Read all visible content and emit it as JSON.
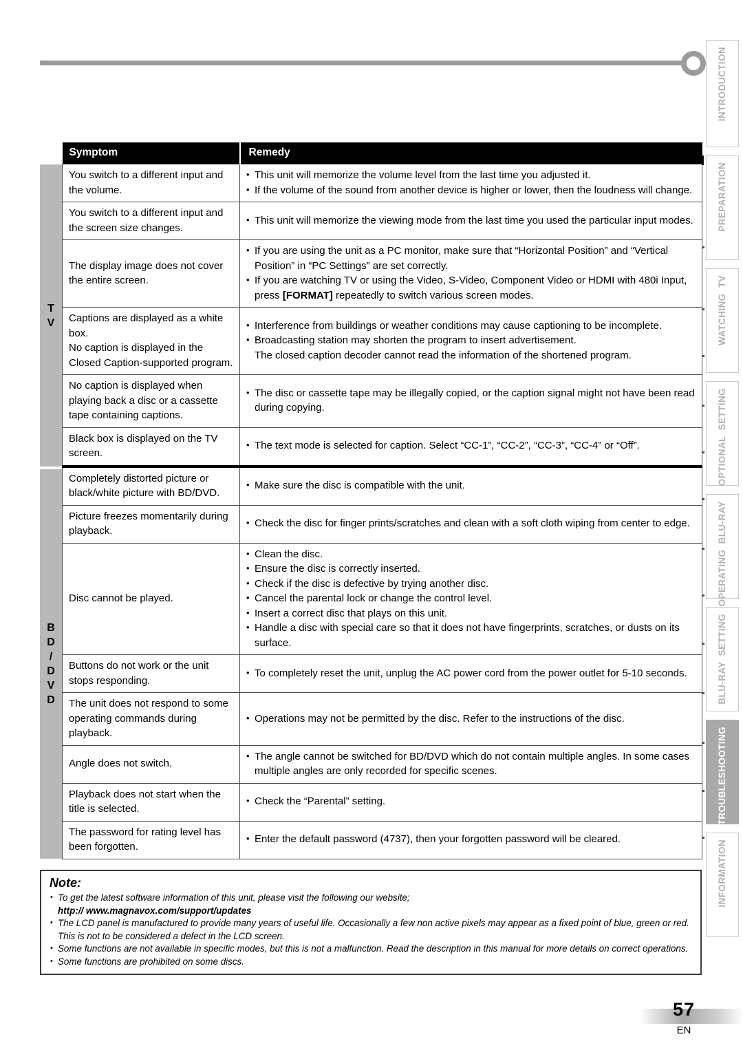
{
  "page": {
    "number": "57",
    "language": "EN"
  },
  "side_tabs": [
    {
      "label": "INTRODUCTION",
      "active": false
    },
    {
      "label": "PREPARATION",
      "active": false
    },
    {
      "label": "WATCHING  TV",
      "active": false
    },
    {
      "label": "OPTIONAL  SETTING",
      "active": false
    },
    {
      "label": "OPERATING  BLU-RAY",
      "active": false
    },
    {
      "label": "BLU-RAY  SETTING",
      "active": false
    },
    {
      "label": "TROUBLESHOOTING",
      "active": true
    },
    {
      "label": "INFORMATION",
      "active": false
    }
  ],
  "categories": {
    "tv": "T\nV",
    "bddvd": "B\nD\n/\nD\nV\nD"
  },
  "table": {
    "headers": {
      "symptom": "Symptom",
      "remedy": "Remedy"
    },
    "rows": [
      {
        "symptom": "You switch to a different input and the volume.",
        "remedy": [
          "This unit will memorize the volume level from the last time you adjusted it.",
          "If the volume of the sound from another device is higher or lower, then the loudness will change."
        ]
      },
      {
        "symptom": "You switch to a different input and the screen size changes.",
        "remedy": [
          "This unit will memorize the viewing mode from the last time you used the particular input modes."
        ]
      },
      {
        "symptom": "The display image does not cover the entire screen.",
        "remedy": [
          "If you are using the unit as a PC monitor, make sure that “Horizontal Position” and “Vertical Position” in “PC Settings” are set correctly.",
          "If you are watching TV or using the Video, S-Video, Component Video or HDMI with 480i Input, press [FORMAT] repeatedly to switch various screen modes."
        ]
      },
      {
        "symptom": "Captions are displayed as a white box.\nNo caption is displayed in the Closed Caption-supported program.",
        "remedy": [
          "Interference from buildings or weather conditions may cause captioning to be incomplete.",
          "Broadcasting station may shorten the program to insert advertisement.\nThe closed caption decoder cannot read the information of the shortened program."
        ]
      },
      {
        "symptom": "No caption is displayed when playing back a disc or a cassette tape containing captions.",
        "remedy": [
          "The disc or cassette tape may be illegally copied, or the caption signal might not have been read during copying."
        ]
      },
      {
        "symptom": "Black box is displayed on the TV screen.",
        "remedy": [
          "The text mode is selected for caption. Select “CC-1”, “CC-2”, “CC-3”, “CC-4” or “Off”."
        ]
      },
      {
        "symptom": "Completely distorted picture or black/white picture with BD/DVD.",
        "remedy": [
          "Make sure the disc is compatible with the unit."
        ]
      },
      {
        "symptom": "Picture freezes momentarily during playback.",
        "remedy": [
          "Check the disc for finger prints/scratches and clean with a soft cloth wiping from center to edge."
        ]
      },
      {
        "symptom": "Disc cannot be played.",
        "remedy": [
          "Clean the disc.",
          "Ensure the disc is correctly inserted.",
          "Check if the disc is defective by trying another disc.",
          "Cancel the parental lock or change the control level.",
          "Insert a correct disc that plays on this unit.",
          "Handle a disc with special care so that it does not have fingerprints, scratches, or dusts on its surface."
        ]
      },
      {
        "symptom": "Buttons do not work or the unit stops responding.",
        "remedy": [
          "To completely reset the unit, unplug the AC power cord from the power outlet for 5-10 seconds."
        ]
      },
      {
        "symptom": "The unit does not respond to some operating commands during playback.",
        "remedy": [
          "Operations may not be permitted by the disc. Refer to the instructions of the disc."
        ]
      },
      {
        "symptom": "Angle does not switch.",
        "remedy": [
          "The angle cannot be switched for BD/DVD which do not contain multiple angles. In some cases multiple angles are only recorded for specific scenes."
        ]
      },
      {
        "symptom": "Playback does not start when the title is selected.",
        "remedy": [
          "Check the “Parental” setting."
        ]
      },
      {
        "symptom": "The password for rating level has been forgotten.",
        "remedy": [
          "Enter the default password (4737), then your forgotten password will be cleared."
        ]
      }
    ]
  },
  "note": {
    "title": "Note:",
    "items": [
      {
        "text": "To get the latest software information of this unit, please visit the following our website;",
        "url": "http:// www.magnavox.com/support/updates"
      },
      {
        "text": "The LCD panel is manufactured to provide many years of useful life. Occasionally a few non active pixels may appear as a fixed point of blue, green or red. This is not to be considered a defect in the LCD screen."
      },
      {
        "text": "Some functions are not available in specific modes, but this is not a malfunction. Read the description in this manual  for more details on correct operations."
      },
      {
        "text": "Some functions are prohibited on some discs."
      }
    ]
  },
  "colors": {
    "header_bg": "#000000",
    "category_bar": "#b8b8b8",
    "active_tab": "#a9a9a9",
    "rule": "#9b9b9b"
  }
}
